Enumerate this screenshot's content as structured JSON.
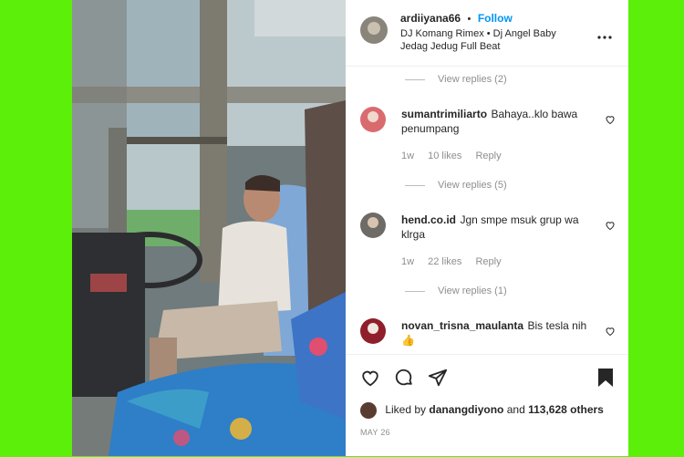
{
  "header": {
    "username": "ardiiyana66",
    "separator": "•",
    "follow_label": "Follow",
    "audio_line1": "DJ Komang Rimex • Dj Angel Baby",
    "audio_line2": "Jedag Jedug Full Beat",
    "more_icon": "ellipsis-icon"
  },
  "comments": [
    {
      "type": "view_replies",
      "label": "View replies (2)"
    },
    {
      "username": "sumantrimiliarto",
      "text_line1": "Bahaya..klo bawa",
      "text_line2": "penumpang",
      "time": "1w",
      "likes": "10 likes",
      "reply": "Reply",
      "view_replies": "View replies (5)"
    },
    {
      "username": "hend.co.id",
      "text_line1": "Jgn smpe msuk grup wa",
      "text_line2": "klrga",
      "time": "1w",
      "likes": "22 likes",
      "reply": "Reply",
      "view_replies": "View replies (1)"
    },
    {
      "username": "novan_trisna_maulanta",
      "text_line1": "Bis tesla nih",
      "emoji": "👍"
    }
  ],
  "actions": {
    "like_icon": "heart-icon",
    "comment_icon": "comment-icon",
    "share_icon": "send-icon",
    "save_icon": "bookmark-icon",
    "liked_by_prefix": "Liked by",
    "liked_by_user": "danangdiyono",
    "liked_by_mid": "and",
    "liked_by_count": "113,628 others",
    "date": "MAY 26"
  },
  "colors": {
    "background": "#5bef0a",
    "link": "#0095f6",
    "text": "#262626",
    "muted": "#8e8e8e"
  }
}
